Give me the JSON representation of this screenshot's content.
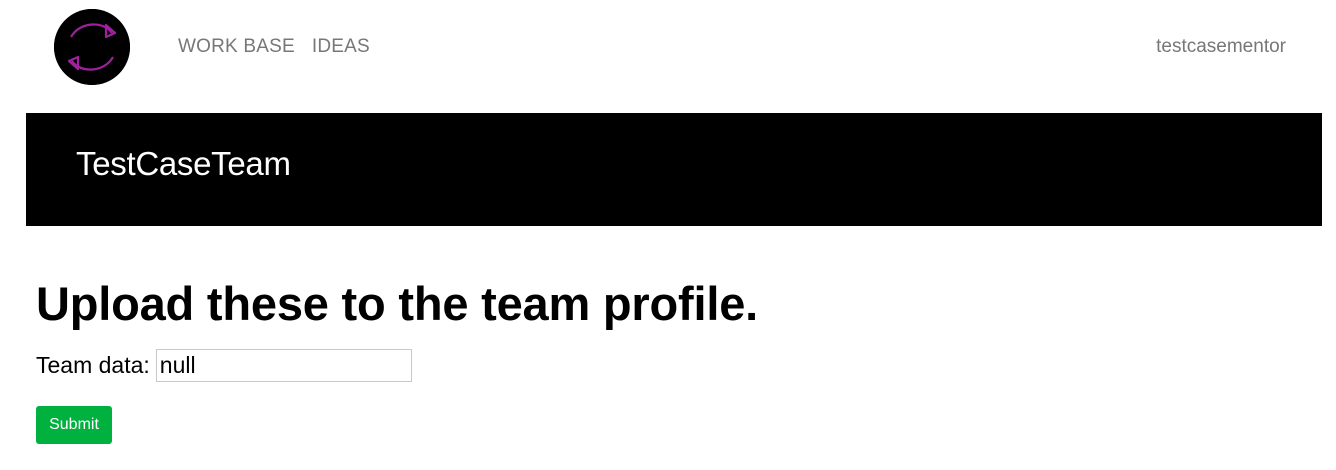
{
  "navbar": {
    "logo_icon": "sync-arrows-icon",
    "accent_color": "#a020a0",
    "links": [
      {
        "label": "WORK BASE"
      },
      {
        "label": "IDEAS"
      }
    ],
    "user": "testcasementor"
  },
  "banner": {
    "title": "TestCaseTeam",
    "background": "#000000"
  },
  "main": {
    "heading": "Upload these to the team profile.",
    "field": {
      "label": "Team data:",
      "value": "null"
    },
    "submit_label": "Submit",
    "submit_color": "#00b140"
  }
}
